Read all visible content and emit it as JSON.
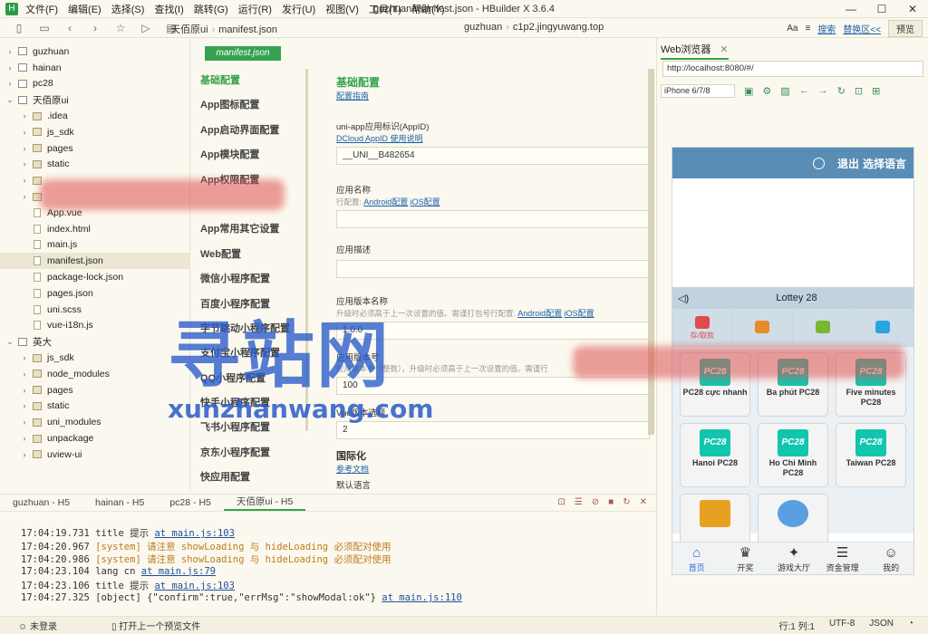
{
  "app": {
    "window_title": "guzhuan/manifest.json - HBuilder X 3.6.4",
    "menu": [
      "文件(F)",
      "编辑(E)",
      "选择(S)",
      "查找(I)",
      "跳转(G)",
      "运行(R)",
      "发行(U)",
      "视图(V)",
      "工具(T)",
      "帮助(Y)"
    ],
    "window_controls": [
      "—",
      "☐",
      "✕"
    ]
  },
  "toolbar": {
    "breadcrumb_left": [
      "天佰原ui",
      "manifest.json"
    ],
    "breadcrumb_right": [
      "guzhuan",
      "c1p2.jingyuwang.top"
    ],
    "search_label": "搜索",
    "replace_label": "替换区<<",
    "preview_label": "预览"
  },
  "sidebar": {
    "items": [
      {
        "label": "guzhuan",
        "kind": "root",
        "depth": 0,
        "chevron": "›"
      },
      {
        "label": "hainan",
        "kind": "root",
        "depth": 0,
        "chevron": "›"
      },
      {
        "label": "pc28",
        "kind": "root",
        "depth": 0,
        "chevron": "›"
      },
      {
        "label": "天佰原ui",
        "kind": "root",
        "depth": 0,
        "chevron": "⌄"
      },
      {
        "label": ".idea",
        "kind": "folder",
        "depth": 1,
        "chevron": "›"
      },
      {
        "label": "js_sdk",
        "kind": "folder",
        "depth": 1,
        "chevron": "›"
      },
      {
        "label": "pages",
        "kind": "folder",
        "depth": 1,
        "chevron": "›"
      },
      {
        "label": "static",
        "kind": "folder",
        "depth": 1,
        "chevron": "›"
      },
      {
        "label": "",
        "kind": "folder",
        "depth": 1,
        "chevron": "›"
      },
      {
        "label": "",
        "kind": "folder",
        "depth": 1,
        "chevron": "›"
      },
      {
        "label": "App.vue",
        "kind": "file",
        "depth": 1,
        "chevron": ""
      },
      {
        "label": "index.html",
        "kind": "file",
        "depth": 1,
        "chevron": ""
      },
      {
        "label": "main.js",
        "kind": "file",
        "depth": 1,
        "chevron": ""
      },
      {
        "label": "manifest.json",
        "kind": "file",
        "depth": 1,
        "chevron": "",
        "selected": true
      },
      {
        "label": "package-lock.json",
        "kind": "file",
        "depth": 1,
        "chevron": ""
      },
      {
        "label": "pages.json",
        "kind": "file",
        "depth": 1,
        "chevron": ""
      },
      {
        "label": "uni.scss",
        "kind": "file",
        "depth": 1,
        "chevron": ""
      },
      {
        "label": "vue-i18n.js",
        "kind": "file",
        "depth": 1,
        "chevron": ""
      },
      {
        "label": "英大",
        "kind": "root",
        "depth": 0,
        "chevron": "⌄"
      },
      {
        "label": "js_sdk",
        "kind": "folder",
        "depth": 1,
        "chevron": "›"
      },
      {
        "label": "node_modules",
        "kind": "folder",
        "depth": 1,
        "chevron": "›"
      },
      {
        "label": "pages",
        "kind": "folder",
        "depth": 1,
        "chevron": "›"
      },
      {
        "label": "static",
        "kind": "folder",
        "depth": 1,
        "chevron": "›"
      },
      {
        "label": "uni_modules",
        "kind": "folder",
        "depth": 1,
        "chevron": "›"
      },
      {
        "label": "unpackage",
        "kind": "folder",
        "depth": 1,
        "chevron": "›"
      },
      {
        "label": "uview-ui",
        "kind": "folder",
        "depth": 1,
        "chevron": "›"
      }
    ]
  },
  "editor": {
    "tab_chip": "manifest.json",
    "nav": [
      "基础配置",
      "App图标配置",
      "App启动界面配置",
      "App模块配置",
      "App权限配置",
      "",
      "App常用其它设置",
      "Web配置",
      "微信小程序配置",
      "百度小程序配置",
      "字节跳动小程序配置",
      "支付宝小程序配置",
      "QQ小程序配置",
      "快手小程序配置",
      "飞书小程序配置",
      "京东小程序配置",
      "快应用配置"
    ],
    "section_title": "基础配置",
    "section_link": "配置指南",
    "fields": {
      "appid_label": "uni-app应用标识(AppID)",
      "appid_link": "DCloud AppID 使用说明",
      "appid_value": "__UNI__B482654",
      "name_label": "应用名称",
      "name_hint": "行配置:",
      "android_link": "Android配置",
      "ios_link": "iOS配置",
      "desc_label": "应用描述",
      "version_label": "应用版本名称",
      "version_hint": "升级时必须高于上一次设置的值。需谨打包号行配置:",
      "version_value": "1.0.0",
      "code_label": "应用版本号",
      "code_hint": "应用版本号（整数），升级时必须高于上一次设置的值。需谨行",
      "code_value": "100",
      "vue_label": "Vue版本选择",
      "vue_value": "2"
    },
    "i18n_title": "国际化",
    "i18n_link": "参考文档",
    "default_lang": "默认语言"
  },
  "browser": {
    "tab_label": "Web浏览器",
    "url": "http://localhost:8080/#/",
    "device": "iPhone 6/7/8"
  },
  "phone": {
    "header_actions": [
      "退出",
      "选择语言"
    ],
    "notice": "Lottey 28",
    "quick_actions": [
      {
        "label": "存/取款",
        "color": "#e04a4a"
      },
      {
        "label": "",
        "color": "#e78a2b"
      },
      {
        "label": "",
        "color": "#7bb534"
      },
      {
        "label": "",
        "color": "#2aa3e0"
      }
    ],
    "games": [
      {
        "name": "PC28 cực nhanh"
      },
      {
        "name": "Ba phút PC28"
      },
      {
        "name": "Five minutes PC28"
      },
      {
        "name": "Hanoi PC28"
      },
      {
        "name": "Ho Chi Minh PC28"
      },
      {
        "name": "Taiwan PC28"
      },
      {
        "name": ""
      },
      {
        "name": ""
      }
    ],
    "tabs": [
      {
        "label": "首页",
        "icon": "home-icon",
        "glyph": "⌂",
        "active": true
      },
      {
        "label": "开奖",
        "icon": "trophy-icon",
        "glyph": "♛",
        "active": false
      },
      {
        "label": "游戏大厅",
        "icon": "gamepad-icon",
        "glyph": "✦",
        "active": false
      },
      {
        "label": "资金管理",
        "icon": "coins-icon",
        "glyph": "☰",
        "active": false
      },
      {
        "label": "我的",
        "icon": "user-icon",
        "glyph": "☺",
        "active": false
      }
    ]
  },
  "console": {
    "tabs": [
      "guzhuan - H5",
      "hainan - H5",
      "pc28 - H5",
      "天佰原ui - H5"
    ],
    "lines": [
      {
        "time": "17:04:19.731",
        "text": "title 提示",
        "link": "at main.js:103",
        "kind": "info"
      },
      {
        "time": "17:04:20.967",
        "text": "[system] 请注意 showLoading 与 hideLoading 必须配对使用",
        "link": "",
        "kind": "warn"
      },
      {
        "time": "17:04:20.986",
        "text": "[system] 请注意 showLoading 与 hideLoading 必须配对使用",
        "link": "",
        "kind": "warn"
      },
      {
        "time": "17:04:23.104",
        "text": "lang cn",
        "link": "at main.js:79",
        "kind": "info"
      },
      {
        "time": "17:04:23.106",
        "text": "title 提示",
        "link": "at main.js:103",
        "kind": "info"
      },
      {
        "time": "17:04:27.325",
        "text": "[object] {\"confirm\":true,\"errMsg\":\"showModal:ok\"}",
        "link": "at main.js:110",
        "kind": "object"
      }
    ]
  },
  "status": {
    "login": "未登录",
    "hint": "打开上一个预览文件",
    "position": "行:1  列:1",
    "encoding": "UTF-8",
    "lang": "JSON"
  },
  "watermark": {
    "big": "寻站网",
    "small": "xunzhanwang.com"
  },
  "colors": {
    "accent_green": "#36a251",
    "link_blue": "#1f5fa8",
    "phone_header": "#5a8db5"
  }
}
